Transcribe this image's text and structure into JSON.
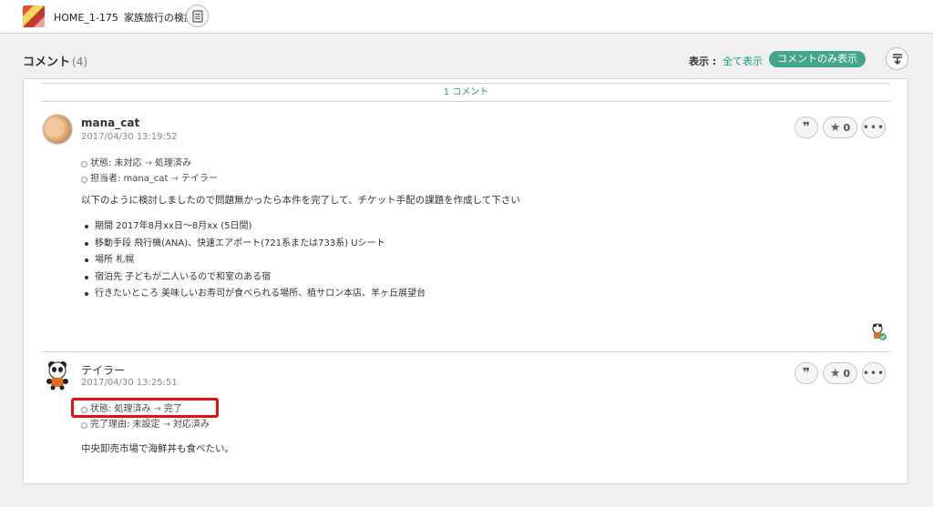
{
  "header": {
    "issue_key": "HOME_1-175",
    "issue_summary": "家族旅行の検討",
    "project_icon": "project-avatar",
    "doc_icon": "document-icon"
  },
  "comments_section": {
    "title": "コメント",
    "count": "(4)",
    "display_label": "表示 :",
    "show_all": "全て表示",
    "show_comments_only": "コメントのみ表示",
    "sort_icon": "sort-down-icon",
    "comment_count_bar": "1 コメント"
  },
  "comments": [
    {
      "user": "mana_cat",
      "timestamp": "2017/04/30 13:19:52",
      "changes": [
        {
          "field": "状態: 未対応",
          "arrow": "→",
          "new": "処理済み"
        },
        {
          "field": "担当者: mana_cat",
          "arrow": "→",
          "new": "テイラー"
        }
      ],
      "text": "以下のように検討しましたので問題無かったら本件を完了して、チケット手配の課題を作成して下さい",
      "bullets": [
        "期間 2017年8月xx日～8月xx (5日間)",
        "移動手段 飛行機(ANA)、快速エアポート(721系または733系) Uシート",
        "場所 札幌",
        "宿泊先 子どもが二人いるので和室のある宿",
        "行きたいところ 美味しいお寿司が食べられる場所、植サロン本店、羊ヶ丘展望台"
      ],
      "star_count": "0",
      "more": "•••"
    },
    {
      "user": "テイラー",
      "timestamp": "2017/04/30 13:25:51",
      "changes": [
        {
          "field": "状態: 処理済み",
          "arrow": "→",
          "new": "完了"
        },
        {
          "field": "完了理由: 未設定",
          "arrow": "→",
          "new": "対応済み"
        }
      ],
      "text": "中央卸売市場で海鮮丼も食べたい。",
      "star_count": "0",
      "more": "•••"
    }
  ],
  "colors": {
    "accent": "#45a58a",
    "link": "#1a9c7e",
    "highlight": "#e01010"
  }
}
